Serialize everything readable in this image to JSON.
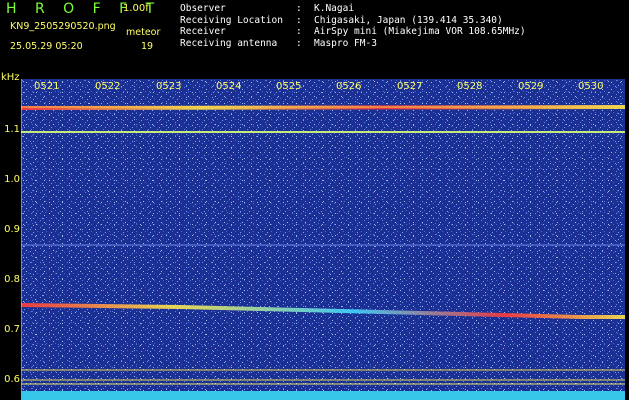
{
  "header": {
    "app_title": "H R O F F T",
    "version": "1.00f",
    "filename": "KN9_2505290520.png",
    "meteor_label": "meteor",
    "timestamp": "25.05.29 05:20",
    "count": "19",
    "info": [
      {
        "key": "Observer",
        "value": "K.Nagai"
      },
      {
        "key": "Receiving Location",
        "value": "Chigasaki, Japan (139.414 35.340)"
      },
      {
        "key": "Receiver",
        "value": "AirSpy mini (Miakejima VOR 108.65MHz)"
      },
      {
        "key": "Receiving antenna",
        "value": "Maspro FM-3"
      }
    ]
  },
  "spectrogram": {
    "unit": "kHz",
    "y_ticks": [
      "1.1",
      "1.0",
      "0.9",
      "0.8",
      "0.7",
      "0.6"
    ],
    "x_ticks": [
      "0521",
      "0522",
      "0523",
      "0524",
      "0525",
      "0526",
      "0527",
      "0528",
      "0529",
      "0530"
    ],
    "colors": {
      "background": "#1c2f93",
      "trace_red": "#ff3a3a",
      "trace_yellow": "#ffe64a",
      "trace_cyan": "#41d7ff",
      "label": "#ffff66"
    }
  }
}
